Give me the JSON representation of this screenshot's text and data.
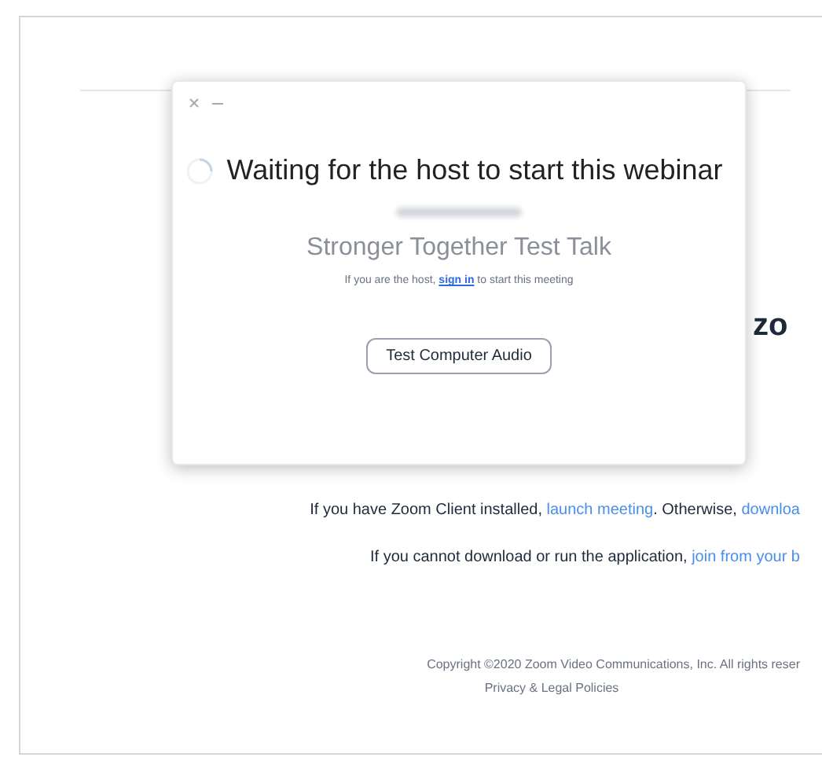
{
  "dialog": {
    "title": "Waiting for the host to start this webinar",
    "meeting_topic": "Stronger Together Test Talk",
    "host_note": [
      {
        "kind": "text",
        "text": "If you are the host, "
      },
      {
        "kind": "link",
        "text": "sign in"
      },
      {
        "kind": "text",
        "text": " to start this meeting"
      }
    ],
    "button": "Test Computer Audio"
  },
  "logo": "zo",
  "lines": [
    {
      "parts": [
        {
          "kind": "text",
          "text": "If you have Zoom Client installed, "
        },
        {
          "kind": "link",
          "text": "launch meeting"
        },
        {
          "kind": "text",
          "text": ". Otherwise, "
        },
        {
          "kind": "link",
          "text": "downloa"
        }
      ]
    },
    {
      "parts": [
        {
          "kind": "text",
          "text": "If you cannot download or run the application, "
        },
        {
          "kind": "link",
          "text": "join from your b"
        }
      ]
    }
  ],
  "footer": {
    "copyright": "Copyright ©2020 Zoom Video Communications, Inc. All rights reser",
    "link": "Privacy & Legal Policies"
  }
}
